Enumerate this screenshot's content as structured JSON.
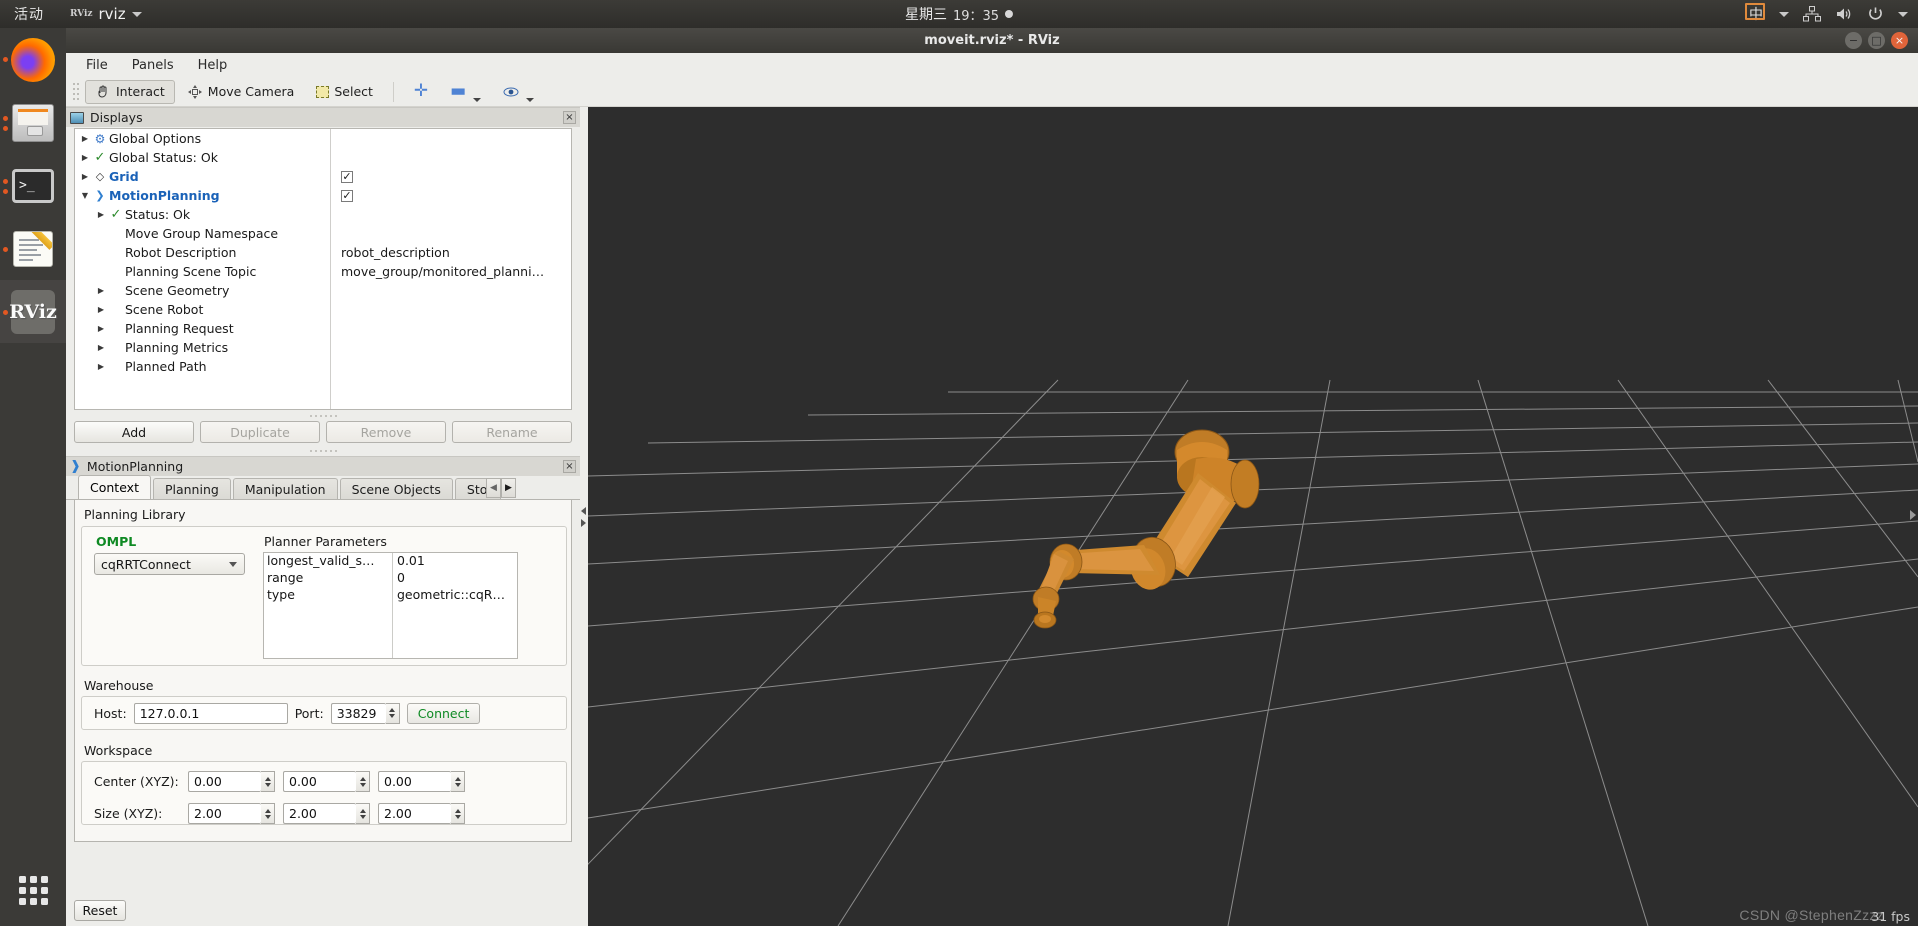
{
  "topbar": {
    "activities": "活动",
    "app_icon_label": "RViz",
    "app_name": "rviz",
    "clock_day": "星期三",
    "clock_time": "19：35",
    "ime": "中",
    "icons": [
      "network-icon",
      "volume-icon",
      "power-icon"
    ]
  },
  "dock": {
    "items": [
      {
        "name": "firefox",
        "label": "Firefox"
      },
      {
        "name": "files",
        "label": "Files"
      },
      {
        "name": "terminal",
        "label": "Terminal"
      },
      {
        "name": "text-editor",
        "label": "Text Editor"
      },
      {
        "name": "rviz",
        "label": "RViz"
      }
    ],
    "show_apps_label": "Show Applications"
  },
  "window": {
    "title": "moveit.rviz* - RViz",
    "controls": {
      "minimize": "−",
      "maximize": "□",
      "close": "×"
    }
  },
  "menubar": {
    "items": [
      "File",
      "Panels",
      "Help"
    ]
  },
  "toolbar": {
    "interact": "Interact",
    "move_camera": "Move Camera",
    "select": "Select",
    "focus_camera_icon": "plus-icon",
    "measure_icon": "minus-icon",
    "publish_point_icon": "eye-icon"
  },
  "displays_panel": {
    "title": "Displays",
    "close_label": "×",
    "rows": [
      {
        "indent": 0,
        "arrow": "▶",
        "icon": "gear-icon",
        "label": "Global Options",
        "blue": false,
        "value": "",
        "check": null
      },
      {
        "indent": 0,
        "arrow": "▶",
        "icon": "check-icon",
        "label": "Global Status: Ok",
        "blue": false,
        "value": "",
        "check": null
      },
      {
        "indent": 0,
        "arrow": "▶",
        "icon": "grid-icon",
        "label": "Grid",
        "blue": true,
        "value": "",
        "check": true
      },
      {
        "indent": 0,
        "arrow": "▼",
        "icon": "motionplanning-icon",
        "label": "MotionPlanning",
        "blue": true,
        "value": "",
        "check": true
      },
      {
        "indent": 1,
        "arrow": "▶",
        "icon": "check-icon",
        "label": "Status: Ok",
        "blue": false,
        "value": "",
        "check": null
      },
      {
        "indent": 1,
        "arrow": "",
        "icon": "",
        "label": "Move Group Namespace",
        "blue": false,
        "value": "",
        "check": null
      },
      {
        "indent": 1,
        "arrow": "",
        "icon": "",
        "label": "Robot Description",
        "blue": false,
        "value": "robot_description",
        "check": null
      },
      {
        "indent": 1,
        "arrow": "",
        "icon": "",
        "label": "Planning Scene Topic",
        "blue": false,
        "value": "move_group/monitored_planni…",
        "check": null
      },
      {
        "indent": 1,
        "arrow": "▶",
        "icon": "",
        "label": "Scene Geometry",
        "blue": false,
        "value": "",
        "check": null
      },
      {
        "indent": 1,
        "arrow": "▶",
        "icon": "",
        "label": "Scene Robot",
        "blue": false,
        "value": "",
        "check": null
      },
      {
        "indent": 1,
        "arrow": "▶",
        "icon": "",
        "label": "Planning Request",
        "blue": false,
        "value": "",
        "check": null
      },
      {
        "indent": 1,
        "arrow": "▶",
        "icon": "",
        "label": "Planning Metrics",
        "blue": false,
        "value": "",
        "check": null
      },
      {
        "indent": 1,
        "arrow": "▶",
        "icon": "",
        "label": "Planned Path",
        "blue": false,
        "value": "",
        "check": null
      }
    ],
    "buttons": [
      {
        "label": "Add",
        "enabled": true
      },
      {
        "label": "Duplicate",
        "enabled": false
      },
      {
        "label": "Remove",
        "enabled": false
      },
      {
        "label": "Rename",
        "enabled": false
      }
    ]
  },
  "motion_planning": {
    "title": "MotionPlanning",
    "close_label": "×",
    "tabs": [
      {
        "label": "Context",
        "active": true
      },
      {
        "label": "Planning",
        "active": false
      },
      {
        "label": "Manipulation",
        "active": false
      },
      {
        "label": "Scene Objects",
        "active": false
      },
      {
        "label": "Stored",
        "active": false
      }
    ],
    "scroll_left": "◀",
    "scroll_right": "▶",
    "context": {
      "planning_library_label": "Planning Library",
      "ompl_label": "OMPL",
      "planner_select": "cqRRTConnect",
      "planner_parameters_label": "Planner Parameters",
      "planner_parameters": [
        {
          "key": "longest_valid_s…",
          "value": "0.01"
        },
        {
          "key": "range",
          "value": "0"
        },
        {
          "key": "type",
          "value": "geometric::cqR…"
        }
      ],
      "warehouse_label": "Warehouse",
      "host_label": "Host:",
      "host_value": "127.0.0.1",
      "port_label": "Port:",
      "port_value": "33829",
      "connect_label": "Connect",
      "workspace_label": "Workspace",
      "center_label": "Center (XYZ):",
      "center_values": [
        "0.00",
        "0.00",
        "0.00"
      ],
      "size_label": "Size (XYZ):",
      "size_values": [
        "2.00",
        "2.00",
        "2.00"
      ]
    }
  },
  "bottom": {
    "reset_label": "Reset"
  },
  "view3d": {
    "fps": "31 fps",
    "watermark": "CSDN @StephenZzzz",
    "background_color": "#2d2d2d",
    "grid_color": "#9a9a9a",
    "robot_color": "#d98a2b"
  }
}
